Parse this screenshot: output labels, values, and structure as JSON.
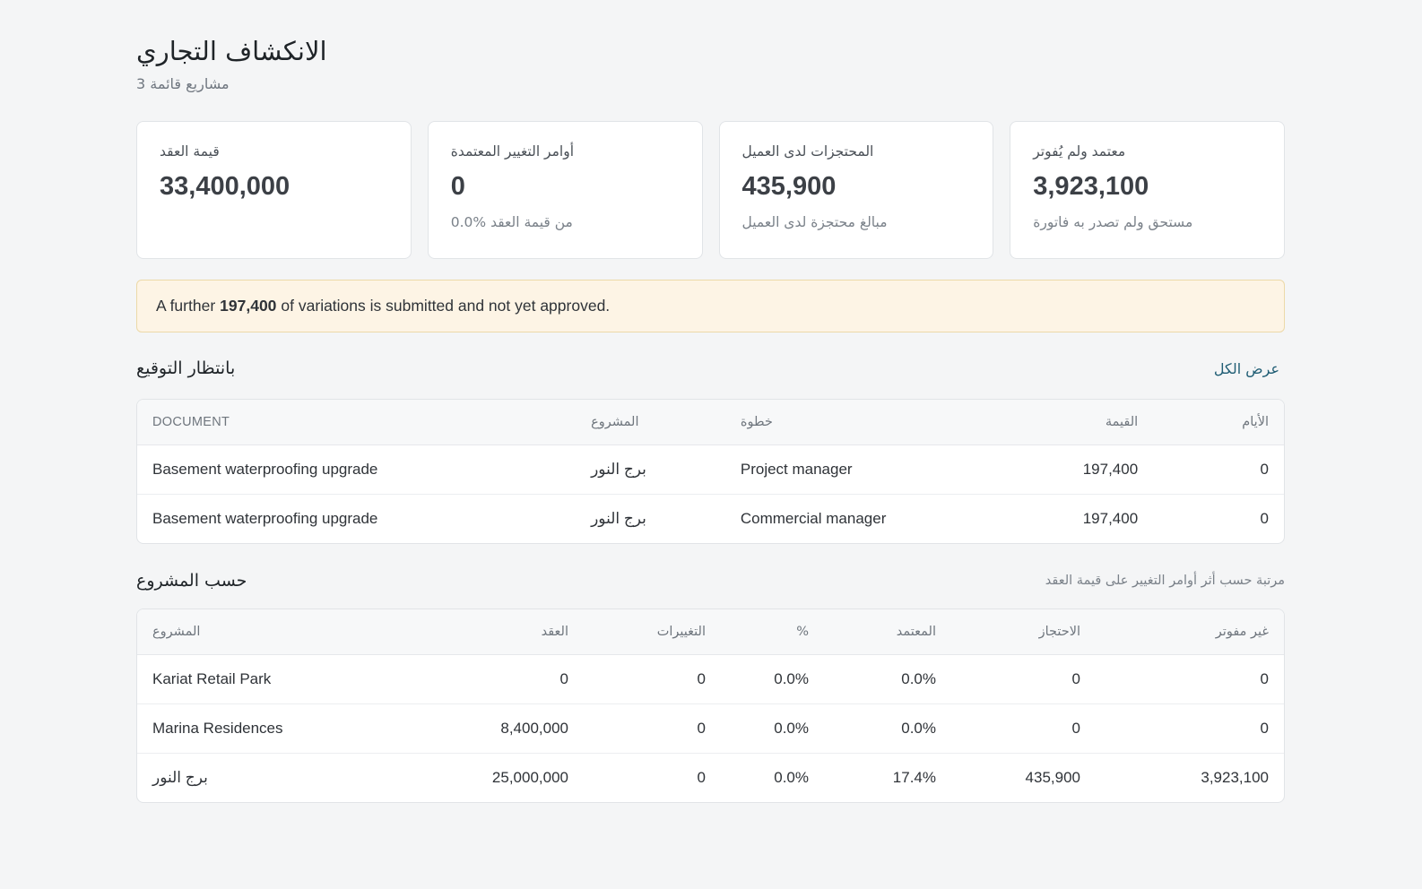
{
  "header": {
    "title": "الانكشاف التجاري",
    "subtitle": "مشاريع قائمة 3"
  },
  "stats": [
    {
      "label": "قيمة العقد",
      "value": "33,400,000",
      "note": ""
    },
    {
      "label": "أوامر التغيير المعتمدة",
      "value": "0",
      "note": "0.0% من قيمة العقد"
    },
    {
      "label": "المحتجزات لدى العميل",
      "value": "435,900",
      "note": "مبالغ محتجزة لدى العميل"
    },
    {
      "label": "معتمد ولم يُفوتر",
      "value": "3,923,100",
      "note": "مستحق ولم تصدر به فاتورة"
    }
  ],
  "alert": {
    "prefix": "A further",
    "amount": "197,400",
    "suffix": "of variations is submitted and not yet approved."
  },
  "pending": {
    "title": "بانتظار التوقيع",
    "view_all": "عرض الكل",
    "columns": {
      "document": "DOCUMENT",
      "project": "المشروع",
      "step": "خطوة",
      "value": "القيمة",
      "days": "الأيام"
    },
    "rows": [
      {
        "document": "Basement waterproofing upgrade",
        "project": "برج النور",
        "step": "Project manager",
        "value": "197,400",
        "days": "0"
      },
      {
        "document": "Basement waterproofing upgrade",
        "project": "برج النور",
        "step": "Commercial manager",
        "value": "197,400",
        "days": "0"
      }
    ]
  },
  "by_project": {
    "title": "حسب المشروع",
    "note": "مرتبة حسب أثر أوامر التغيير على قيمة العقد",
    "columns": {
      "project": "المشروع",
      "contract": "العقد",
      "variations": "التغييرات",
      "pct": "%",
      "approved": "المعتمد",
      "retention": "الاحتجاز",
      "unbilled": "غير مفوتر"
    },
    "rows": [
      {
        "project": "Kariat Retail Park",
        "contract": "0",
        "variations": "0",
        "pct": "0.0%",
        "approved": "0.0%",
        "retention": "0",
        "unbilled": "0"
      },
      {
        "project": "Marina Residences",
        "contract": "8,400,000",
        "variations": "0",
        "pct": "0.0%",
        "approved": "0.0%",
        "retention": "0",
        "unbilled": "0"
      },
      {
        "project": "برج النور",
        "contract": "25,000,000",
        "variations": "0",
        "pct": "0.0%",
        "approved": "17.4%",
        "retention": "435,900",
        "unbilled": "3,923,100"
      }
    ]
  }
}
